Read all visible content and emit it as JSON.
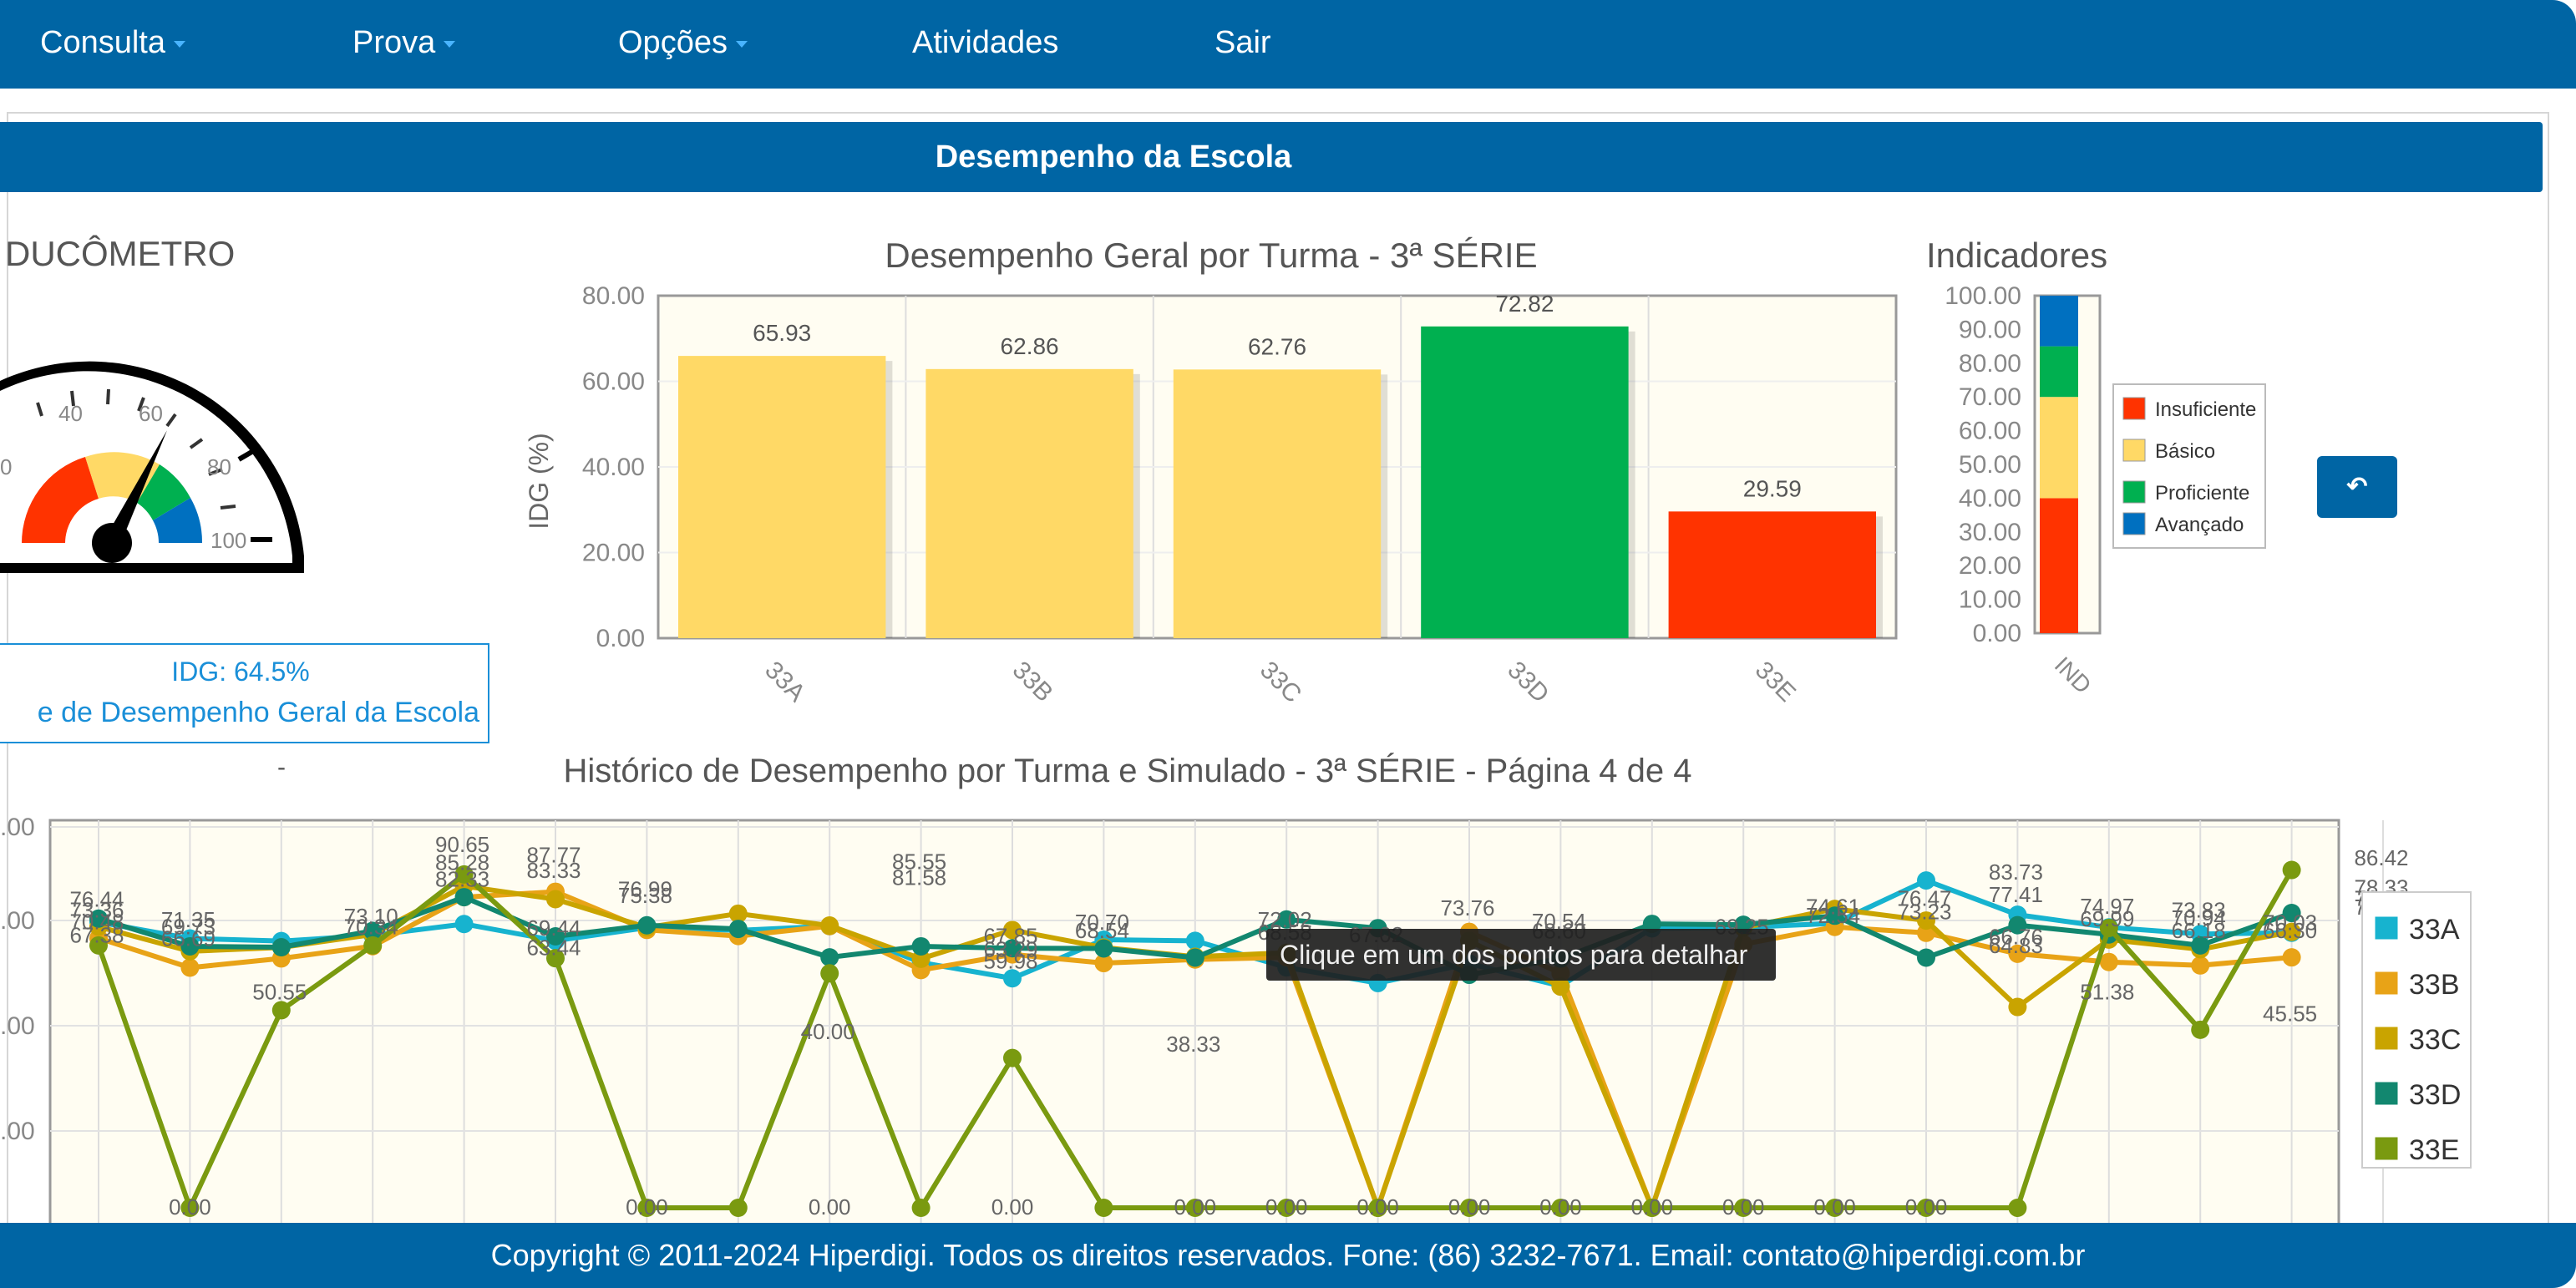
{
  "nav": {
    "items": [
      {
        "label": "Consulta",
        "dropdown": true
      },
      {
        "label": "Prova",
        "dropdown": true
      },
      {
        "label": "Opções",
        "dropdown": true
      },
      {
        "label": "Atividades",
        "dropdown": false
      },
      {
        "label": "Sair",
        "dropdown": false
      }
    ]
  },
  "panel": {
    "title": "Desempenho da Escola"
  },
  "gauge": {
    "title": "DUCÔMETRO",
    "value": 64.5,
    "ticks": [
      "0",
      "40",
      "60",
      "80",
      "100"
    ],
    "idg_text": "IDG: 64.5%",
    "idg_caption": "e de Desempenho Geral da Escola",
    "dash": "-"
  },
  "colors": {
    "insuficiente": "#ff3300",
    "basico": "#ffd966",
    "proficiente": "#00b050",
    "avancado": "#0070c0",
    "nav": "#0065a4"
  },
  "bar_chart": {
    "title": "Desempenho Geral por Turma - 3ª SÉRIE",
    "ylabel": "IDG (%)",
    "yticks": [
      "0.00",
      "20.00",
      "40.00",
      "60.00",
      "80.00"
    ],
    "ylim": [
      0,
      80
    ],
    "categories": [
      "33A",
      "33B",
      "33C",
      "33D",
      "33E"
    ],
    "values": [
      65.93,
      62.86,
      62.76,
      72.82,
      29.59
    ],
    "value_labels": [
      "65.93",
      "62.86",
      "62.76",
      "72.82",
      "29.59"
    ],
    "bar_colors": [
      "#ffd966",
      "#ffd966",
      "#ffd966",
      "#00b050",
      "#ff3300"
    ]
  },
  "indicadores": {
    "title": "Indicadores",
    "yticks": [
      "0.00",
      "10.00",
      "20.00",
      "30.00",
      "40.00",
      "50.00",
      "60.00",
      "70.00",
      "80.00",
      "90.00",
      "100.00"
    ],
    "category": "IND",
    "bands": [
      {
        "name": "Insuficiente",
        "from": 0,
        "to": 40,
        "color": "#ff3300"
      },
      {
        "name": "Básico",
        "from": 40,
        "to": 70,
        "color": "#ffd966"
      },
      {
        "name": "Proficiente",
        "from": 70,
        "to": 85,
        "color": "#00b050"
      },
      {
        "name": "Avançado",
        "from": 85,
        "to": 100,
        "color": "#0070c0"
      }
    ]
  },
  "back_button": {
    "icon": "undo-arrow-icon",
    "glyph": "↶"
  },
  "line_chart": {
    "title": "Histórico de Desempenho por Turma e Simulado - 3ª SÉRIE - Página 4 de 4",
    "yticks": [
      ".00",
      ".00",
      ".00",
      ".00"
    ],
    "tooltip": "Clique em um dos pontos para detalhar",
    "series": [
      {
        "name": "33A",
        "color": "#17b3cf",
        "values": [
          73.08,
          68.9,
          68.23,
          69.7,
          72.6,
          68.34,
          71.66,
          70.98,
          72.07,
          62.74,
          58.71,
          68.58,
          68.29,
          61.5,
          57.5,
          62.48,
          56.73,
          71.48,
          71.74,
          72.78,
          83.73,
          74.97,
          71.75,
          70.03,
          70.36
        ]
      },
      {
        "name": "33B",
        "color": "#e8a317",
        "values": [
          68.97,
          61.44,
          63.8,
          66.93,
          79.47,
          80.86,
          71.09,
          69.52,
          72.07,
          60.83,
          64.82,
          62.6,
          63.51,
          64.07,
          0.0,
          70.6,
          60.0,
          0.0,
          67.43,
          71.86,
          70.34,
          64.99,
          62.88,
          62.01,
          64.07
        ]
      },
      {
        "name": "33C",
        "color": "#c9a400",
        "values": [
          71.91,
          65.63,
          66.6,
          69.93,
          82.3,
          78.95,
          71.73,
          75.25,
          72.21,
          63.71,
          71.06,
          66.58,
          64.23,
          65.25,
          0.0,
          68.29,
          56.59,
          0.0,
          71.66,
          76.47,
          73.49,
          51.38,
          68.62,
          66.13,
          70.59
        ]
      },
      {
        "name": "33D",
        "color": "#12876f",
        "values": [
          73.98,
          66.89,
          66.67,
          70.84,
          79.47,
          69.44,
          72.28,
          71.35,
          64.07,
          66.89,
          66.4,
          66.35,
          64.0,
          73.76,
          71.54,
          59.61,
          63.77,
          72.63,
          72.4,
          74.72,
          64.0,
          72.3,
          69.92,
          67.13,
          75.42
        ]
      },
      {
        "name": "33E",
        "color": "#7a9a10",
        "values": [
          67.13,
          0.0,
          50.55,
          67.13,
          85.28,
          63.85,
          0.0,
          0.0,
          59.98,
          0.0,
          38.33,
          0.0,
          0.0,
          0.0,
          0.0,
          0.0,
          0.0,
          0.0,
          0.0,
          0.0,
          0.0,
          0.0,
          71.58,
          45.55,
          86.42
        ]
      }
    ],
    "point_labels": [
      {
        "text": "76.44",
        "pi": 0,
        "yv": 77.0
      },
      {
        "text": "73.36",
        "pi": 0,
        "yv": 74.2
      },
      {
        "text": "70.48",
        "pi": 0,
        "yv": 71.3
      },
      {
        "text": "67.38",
        "pi": 0,
        "yv": 67.8
      },
      {
        "text": "71.35",
        "pi": 1,
        "yv": 71.8
      },
      {
        "text": "69.73",
        "pi": 1,
        "yv": 70.0
      },
      {
        "text": "66.69",
        "pi": 1,
        "yv": 67.0
      },
      {
        "text": "50.55",
        "pi": 2,
        "yv": 53.3
      },
      {
        "text": "73.10",
        "pi": 3,
        "yv": 72.7
      },
      {
        "text": "70.34",
        "pi": 3,
        "yv": 70.0
      },
      {
        "text": "90.65",
        "pi": 4,
        "yv": 91.0
      },
      {
        "text": "85.28",
        "pi": 4,
        "yv": 86.4
      },
      {
        "text": "82.33",
        "pi": 4,
        "yv": 82.2
      },
      {
        "text": "87.77",
        "pi": 5,
        "yv": 88.4
      },
      {
        "text": "83.33",
        "pi": 5,
        "yv": 84.4
      },
      {
        "text": "69.44",
        "pi": 5,
        "yv": 69.7
      },
      {
        "text": "63.44",
        "pi": 5,
        "yv": 64.6
      },
      {
        "text": "40.00",
        "pi": 8,
        "yv": 43.2
      },
      {
        "text": "76.99",
        "pi": 6,
        "yv": 79.6
      },
      {
        "text": "75.38",
        "pi": 6,
        "yv": 78.0
      },
      {
        "text": "85.55",
        "pi": 9,
        "yv": 86.6
      },
      {
        "text": "81.58",
        "pi": 9,
        "yv": 82.6
      },
      {
        "text": "67.85",
        "pi": 10,
        "yv": 67.6
      },
      {
        "text": "63.29",
        "pi": 10,
        "yv": 64.2
      },
      {
        "text": "59.98",
        "pi": 10,
        "yv": 61.2
      },
      {
        "text": "70.70",
        "pi": 11,
        "yv": 71.2
      },
      {
        "text": "68.54",
        "pi": 11,
        "yv": 69.0
      },
      {
        "text": "38.33",
        "pi": 12,
        "yv": 40.0
      },
      {
        "text": "72.02",
        "pi": 13,
        "yv": 71.8
      },
      {
        "text": "68.58",
        "pi": 13,
        "yv": 68.6
      },
      {
        "text": "67.02",
        "pi": 14,
        "yv": 68.0
      },
      {
        "text": "73.76",
        "pi": 15,
        "yv": 74.8
      },
      {
        "text": "70.54",
        "pi": 16,
        "yv": 71.4
      },
      {
        "text": "68.60",
        "pi": 16,
        "yv": 68.9
      },
      {
        "text": "69.25",
        "pi": 18,
        "yv": 70.0
      },
      {
        "text": "74.61",
        "pi": 19,
        "yv": 75.1
      },
      {
        "text": "72.54",
        "pi": 19,
        "yv": 72.9
      },
      {
        "text": "76.47",
        "pi": 20,
        "yv": 77.2
      },
      {
        "text": "73.23",
        "pi": 20,
        "yv": 73.8
      },
      {
        "text": "83.73",
        "pi": 21,
        "yv": 84.0
      },
      {
        "text": "77.41",
        "pi": 21,
        "yv": 78.2
      },
      {
        "text": "66.76",
        "pi": 21,
        "yv": 67.4
      },
      {
        "text": "64.83",
        "pi": 21,
        "yv": 65.2
      },
      {
        "text": "74.97",
        "pi": 22,
        "yv": 75.2
      },
      {
        "text": "69.99",
        "pi": 22,
        "yv": 72.0
      },
      {
        "text": "51.38",
        "pi": 22,
        "yv": 53.3
      },
      {
        "text": "73.83",
        "pi": 23,
        "yv": 74.2
      },
      {
        "text": "70.94",
        "pi": 23,
        "yv": 72.2
      },
      {
        "text": "66.18",
        "pi": 23,
        "yv": 69.0
      },
      {
        "text": "45.55",
        "pi": 24,
        "yv": 47.8
      },
      {
        "text": "70.03",
        "pi": 24,
        "yv": 71.0
      },
      {
        "text": "66.30",
        "pi": 24,
        "yv": 69.0
      },
      {
        "text": "86.42",
        "pi": 25,
        "yv": 87.6
      },
      {
        "text": "78.33",
        "pi": 25,
        "yv": 80.0
      },
      {
        "text": "76.59",
        "pi": 25,
        "yv": 77.2
      },
      {
        "text": "73.24",
        "pi": 25,
        "yv": 75.0
      }
    ],
    "zero_labels": [
      "0.00",
      "0.00",
      "0.00",
      "0.00",
      "0.00",
      "0.00",
      "0.00",
      "0.00",
      "0.00",
      "0.00",
      "0.00",
      "0.00",
      "0.00"
    ]
  },
  "footer": {
    "text": "Copyright © 2011-2024 Hiperdigi. Todos os direitos reservados. Fone: (86) 3232-7671. Email: contato@hiperdigi.com.br"
  }
}
